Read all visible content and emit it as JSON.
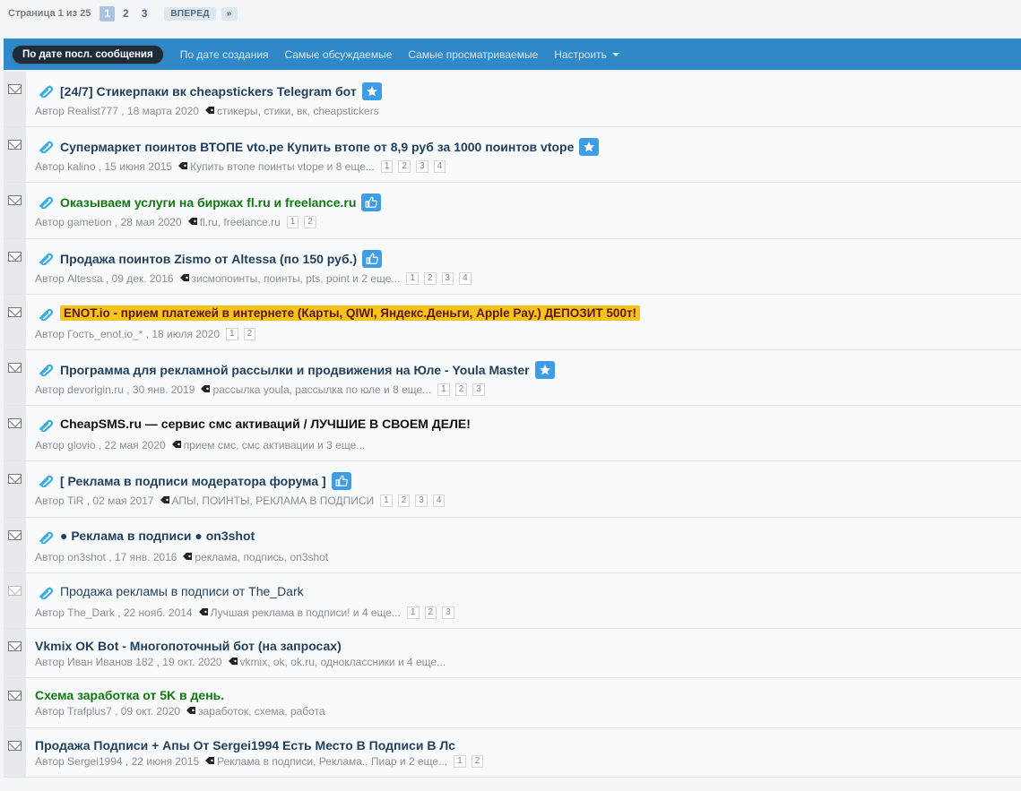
{
  "pager": {
    "label": "Страница 1 из 25",
    "pages": [
      "1",
      "2",
      "3"
    ],
    "current": "1",
    "next_label": "ВПЕРЕД",
    "last_label": "»"
  },
  "tabs": [
    {
      "label": "По дате посл. сообщения",
      "active": true
    },
    {
      "label": "По дате создания",
      "active": false
    },
    {
      "label": "Самые обсуждаемые",
      "active": false
    },
    {
      "label": "Самые просматриваемые",
      "active": false
    },
    {
      "label": "Настроить",
      "active": false,
      "dropdown": true
    }
  ],
  "colors": {
    "accent": "#2f89c9",
    "badge": "#3f9de6",
    "title": "#1f3f5f",
    "green": "#0f7a0f",
    "highlight": "#f6c21b"
  },
  "threads": [
    {
      "title": "[24/7] Стикерпаки вк cheapstickers Telegram бот",
      "style": "bold",
      "badge": "star-icon",
      "author": "Realist777",
      "date": "18 марта 2020",
      "tags": "стикеры, стики, вк, cheapstickers",
      "pages": [],
      "clip": true
    },
    {
      "title": "Супермаркет поинтов ВТОПЕ vto.pe Купить втопе от 8,9 руб за 1000 поинтов vtope",
      "style": "bold",
      "badge": "star-icon",
      "author": "kalino",
      "date": "15 июня 2015",
      "tags": "Купить втопе поинты vtope и 8 еще...",
      "pages": [
        "1",
        "2",
        "3",
        "4"
      ],
      "clip": true
    },
    {
      "title": "Оказываем услуги на биржах fl.ru и freelance.ru",
      "style": "green",
      "badge": "thumbs-up-icon",
      "author": "gametion",
      "date": "28 мая 2020",
      "tags": "fl.ru, freelance.ru",
      "pages": [
        "1",
        "2"
      ],
      "clip": true
    },
    {
      "title": "Продажа поинтов Zismo от Altessa (по 150 руб.)",
      "style": "bold",
      "badge": "thumbs-up-icon",
      "author": "Altessa",
      "date": "09 дек. 2016",
      "tags": "зисмопоинты, поинты, pts, point и 2 еще...",
      "pages": [
        "1",
        "2",
        "3",
        "4"
      ],
      "clip": true
    },
    {
      "title": "ENOT.io - прием платежей в интернете (Карты, QIWI, Яндекс.Деньги, Apple Pay.) ДЕПОЗИТ 500т!",
      "style": "highlight",
      "badge": "",
      "author": "Гость_enot.io_*",
      "date": "18 июля 2020",
      "tags": "",
      "pages": [
        "1",
        "2"
      ],
      "clip": true
    },
    {
      "title": "Программа для рекламной рассылки и продвижения на Юле - Youla Master",
      "style": "bold",
      "badge": "star-icon",
      "author": "devorigin.ru",
      "date": "30 янв. 2019",
      "tags": "рассылка youla, рассылка по юле и 8 еще...",
      "pages": [
        "1",
        "2",
        "3"
      ],
      "clip": true
    },
    {
      "title": "CheapSMS.ru — сервис смс активаций / ЛУЧШИЕ В СВОЕМ ДЕЛЕ!",
      "style": "black",
      "badge": "",
      "author": "glovio",
      "date": "22 мая 2020",
      "tags": "прием смс, смс активации и 3 еще...",
      "pages": [],
      "clip": true
    },
    {
      "title": "[ Реклама в подписи модератора форума ]",
      "style": "bold",
      "badge": "thumbs-up-icon",
      "author": "TiR",
      "date": "02 мая 2017",
      "tags": "АПЫ, ПОИНТЫ, РЕКЛАМА В ПОДПИСИ",
      "pages": [
        "1",
        "2",
        "3",
        "4"
      ],
      "clip": true
    },
    {
      "title": "● Реклама в подписи ● on3shot",
      "style": "bold",
      "badge": "",
      "author": "on3shot",
      "date": "17 янв. 2016",
      "tags": "реклама, подпись, on3shot",
      "pages": [],
      "clip": true
    },
    {
      "title": "Продажа рекламы в подписи от The_Dark",
      "style": "normal",
      "badge": "",
      "author": "The_Dark",
      "date": "22 нояб. 2014",
      "tags": "Лучшая реклама в подписи! и 4 еще...",
      "pages": [
        "1",
        "2",
        "3"
      ],
      "clip": true,
      "read": true
    },
    {
      "title": "Vkmix OK Bot - Многопоточный бот (на запросах)",
      "style": "bold",
      "badge": "",
      "author": "Иван Иванов 182",
      "date": "19 окт. 2020",
      "tags": "vkmix, ok, ok.ru, одноклассники и 4 еще...",
      "pages": [],
      "clip": false
    },
    {
      "title": "Схема заработка от 5K в день.",
      "style": "green",
      "badge": "",
      "author": "Trafplus7",
      "date": "09 окт. 2020",
      "tags": "заработок, схема, работа",
      "pages": [],
      "clip": false
    },
    {
      "title": "Продажа Подписи + Апы От Sergei1994 Есть Место В Подписи В Лс",
      "style": "bold",
      "badge": "",
      "author": "Sergei1994",
      "date": "22 июня 2015",
      "tags": "Реклама в подписи, Реклама., Пиар и 2 еще...",
      "pages": [
        "1",
        "2"
      ],
      "clip": false
    }
  ],
  "meta_prefix": "Автор"
}
